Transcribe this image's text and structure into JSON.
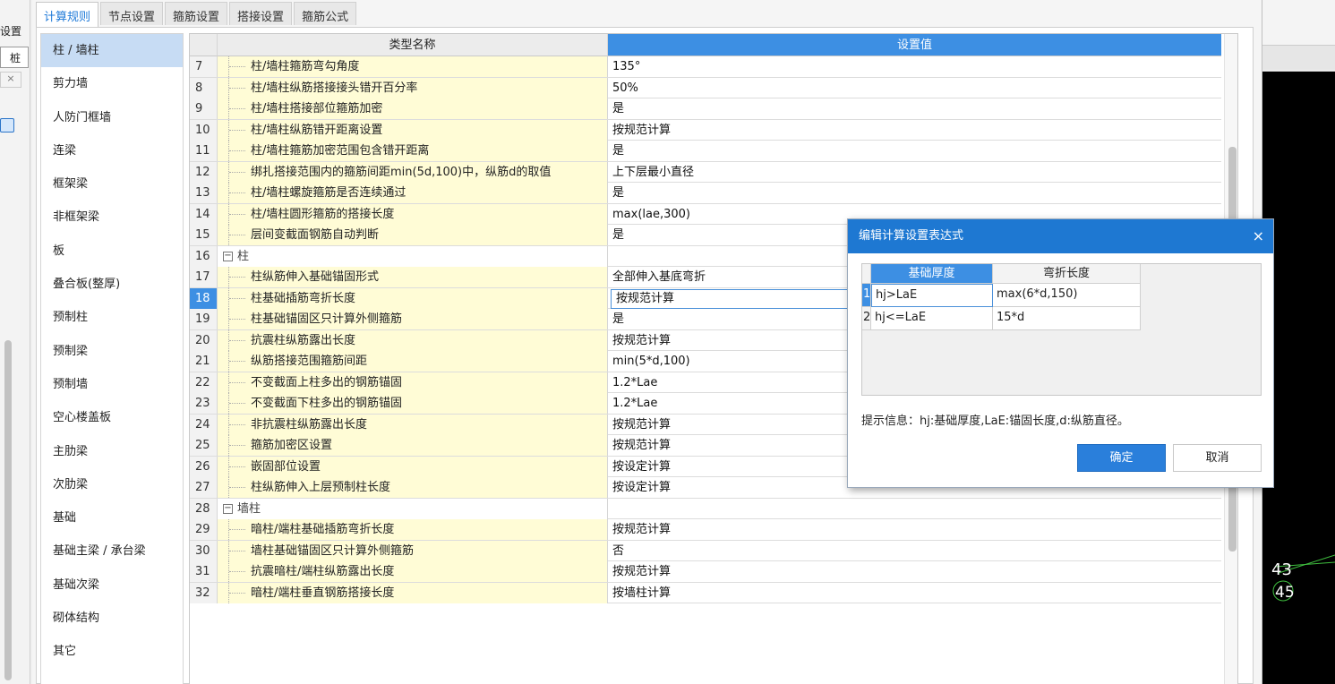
{
  "host": {
    "left_label": "设置",
    "left_tab": "桩"
  },
  "tabs": [
    {
      "label": "计算规则"
    },
    {
      "label": "节点设置"
    },
    {
      "label": "箍筋设置"
    },
    {
      "label": "搭接设置"
    },
    {
      "label": "箍筋公式"
    }
  ],
  "categories": [
    {
      "label": "柱 / 墙柱"
    },
    {
      "label": "剪力墙"
    },
    {
      "label": "人防门框墙"
    },
    {
      "label": "连梁"
    },
    {
      "label": "框架梁"
    },
    {
      "label": "非框架梁"
    },
    {
      "label": "板"
    },
    {
      "label": "叠合板(整厚)"
    },
    {
      "label": "预制柱"
    },
    {
      "label": "预制梁"
    },
    {
      "label": "预制墙"
    },
    {
      "label": "空心楼盖板"
    },
    {
      "label": "主肋梁"
    },
    {
      "label": "次肋梁"
    },
    {
      "label": "基础"
    },
    {
      "label": "基础主梁 / 承台梁"
    },
    {
      "label": "基础次梁"
    },
    {
      "label": "砌体结构"
    },
    {
      "label": "其它"
    }
  ],
  "grid": {
    "col_name": "类型名称",
    "col_value": "设置值",
    "rows": [
      {
        "num": "7",
        "name": "柱/墙柱箍筋弯勾角度",
        "value": "135°"
      },
      {
        "num": "8",
        "name": "柱/墙柱纵筋搭接接头错开百分率",
        "value": "50%"
      },
      {
        "num": "9",
        "name": "柱/墙柱搭接部位箍筋加密",
        "value": "是"
      },
      {
        "num": "10",
        "name": "柱/墙柱纵筋错开距离设置",
        "value": "按规范计算"
      },
      {
        "num": "11",
        "name": "柱/墙柱箍筋加密范围包含错开距离",
        "value": "是"
      },
      {
        "num": "12",
        "name": "绑扎搭接范围内的箍筋间距min(5d,100)中，纵筋d的取值",
        "value": "上下层最小直径"
      },
      {
        "num": "13",
        "name": "柱/墙柱螺旋箍筋是否连续通过",
        "value": "是"
      },
      {
        "num": "14",
        "name": "柱/墙柱圆形箍筋的搭接长度",
        "value": "max(lae,300)"
      },
      {
        "num": "15",
        "name": "层间变截面钢筋自动判断",
        "value": "是"
      },
      {
        "num": "16",
        "name": "柱",
        "value": "",
        "group": true,
        "toggle": "−"
      },
      {
        "num": "17",
        "name": "柱纵筋伸入基础锚固形式",
        "value": "全部伸入基底弯折"
      },
      {
        "num": "18",
        "name": "柱基础插筋弯折长度",
        "value": "按规范计算",
        "selected": true
      },
      {
        "num": "19",
        "name": "柱基础锚固区只计算外侧箍筋",
        "value": "是"
      },
      {
        "num": "20",
        "name": "抗震柱纵筋露出长度",
        "value": "按规范计算"
      },
      {
        "num": "21",
        "name": "纵筋搭接范围箍筋间距",
        "value": "min(5*d,100)"
      },
      {
        "num": "22",
        "name": "不变截面上柱多出的钢筋锚固",
        "value": "1.2*Lae"
      },
      {
        "num": "23",
        "name": "不变截面下柱多出的钢筋锚固",
        "value": "1.2*Lae"
      },
      {
        "num": "24",
        "name": "非抗震柱纵筋露出长度",
        "value": "按规范计算"
      },
      {
        "num": "25",
        "name": "箍筋加密区设置",
        "value": "按规范计算"
      },
      {
        "num": "26",
        "name": "嵌固部位设置",
        "value": "按设定计算"
      },
      {
        "num": "27",
        "name": "柱纵筋伸入上层预制柱长度",
        "value": "按设定计算"
      },
      {
        "num": "28",
        "name": "墙柱",
        "value": "",
        "group": true,
        "toggle": "−"
      },
      {
        "num": "29",
        "name": "暗柱/端柱基础插筋弯折长度",
        "value": "按规范计算"
      },
      {
        "num": "30",
        "name": "墙柱基础锚固区只计算外侧箍筋",
        "value": "否"
      },
      {
        "num": "31",
        "name": "抗震暗柱/端柱纵筋露出长度",
        "value": "按规范计算"
      },
      {
        "num": "32",
        "name": "暗柱/端柱垂直钢筋搭接长度",
        "value": "按墙柱计算"
      }
    ]
  },
  "popup": {
    "title": "编辑计算设置表达式",
    "close": "×",
    "col1": "基础厚度",
    "col2": "弯折长度",
    "rows": [
      {
        "idx": "1",
        "cond": "hj>LaE",
        "value": "max(6*d,150)"
      },
      {
        "idx": "2",
        "cond": "hj<=LaE",
        "value": "15*d"
      }
    ],
    "hint": "提示信息：hj:基础厚度,LaE:锚固长度,d:纵筋直径。",
    "ok": "确定",
    "cancel": "取消"
  },
  "cad": {
    "labels": [
      "43",
      "45"
    ]
  }
}
